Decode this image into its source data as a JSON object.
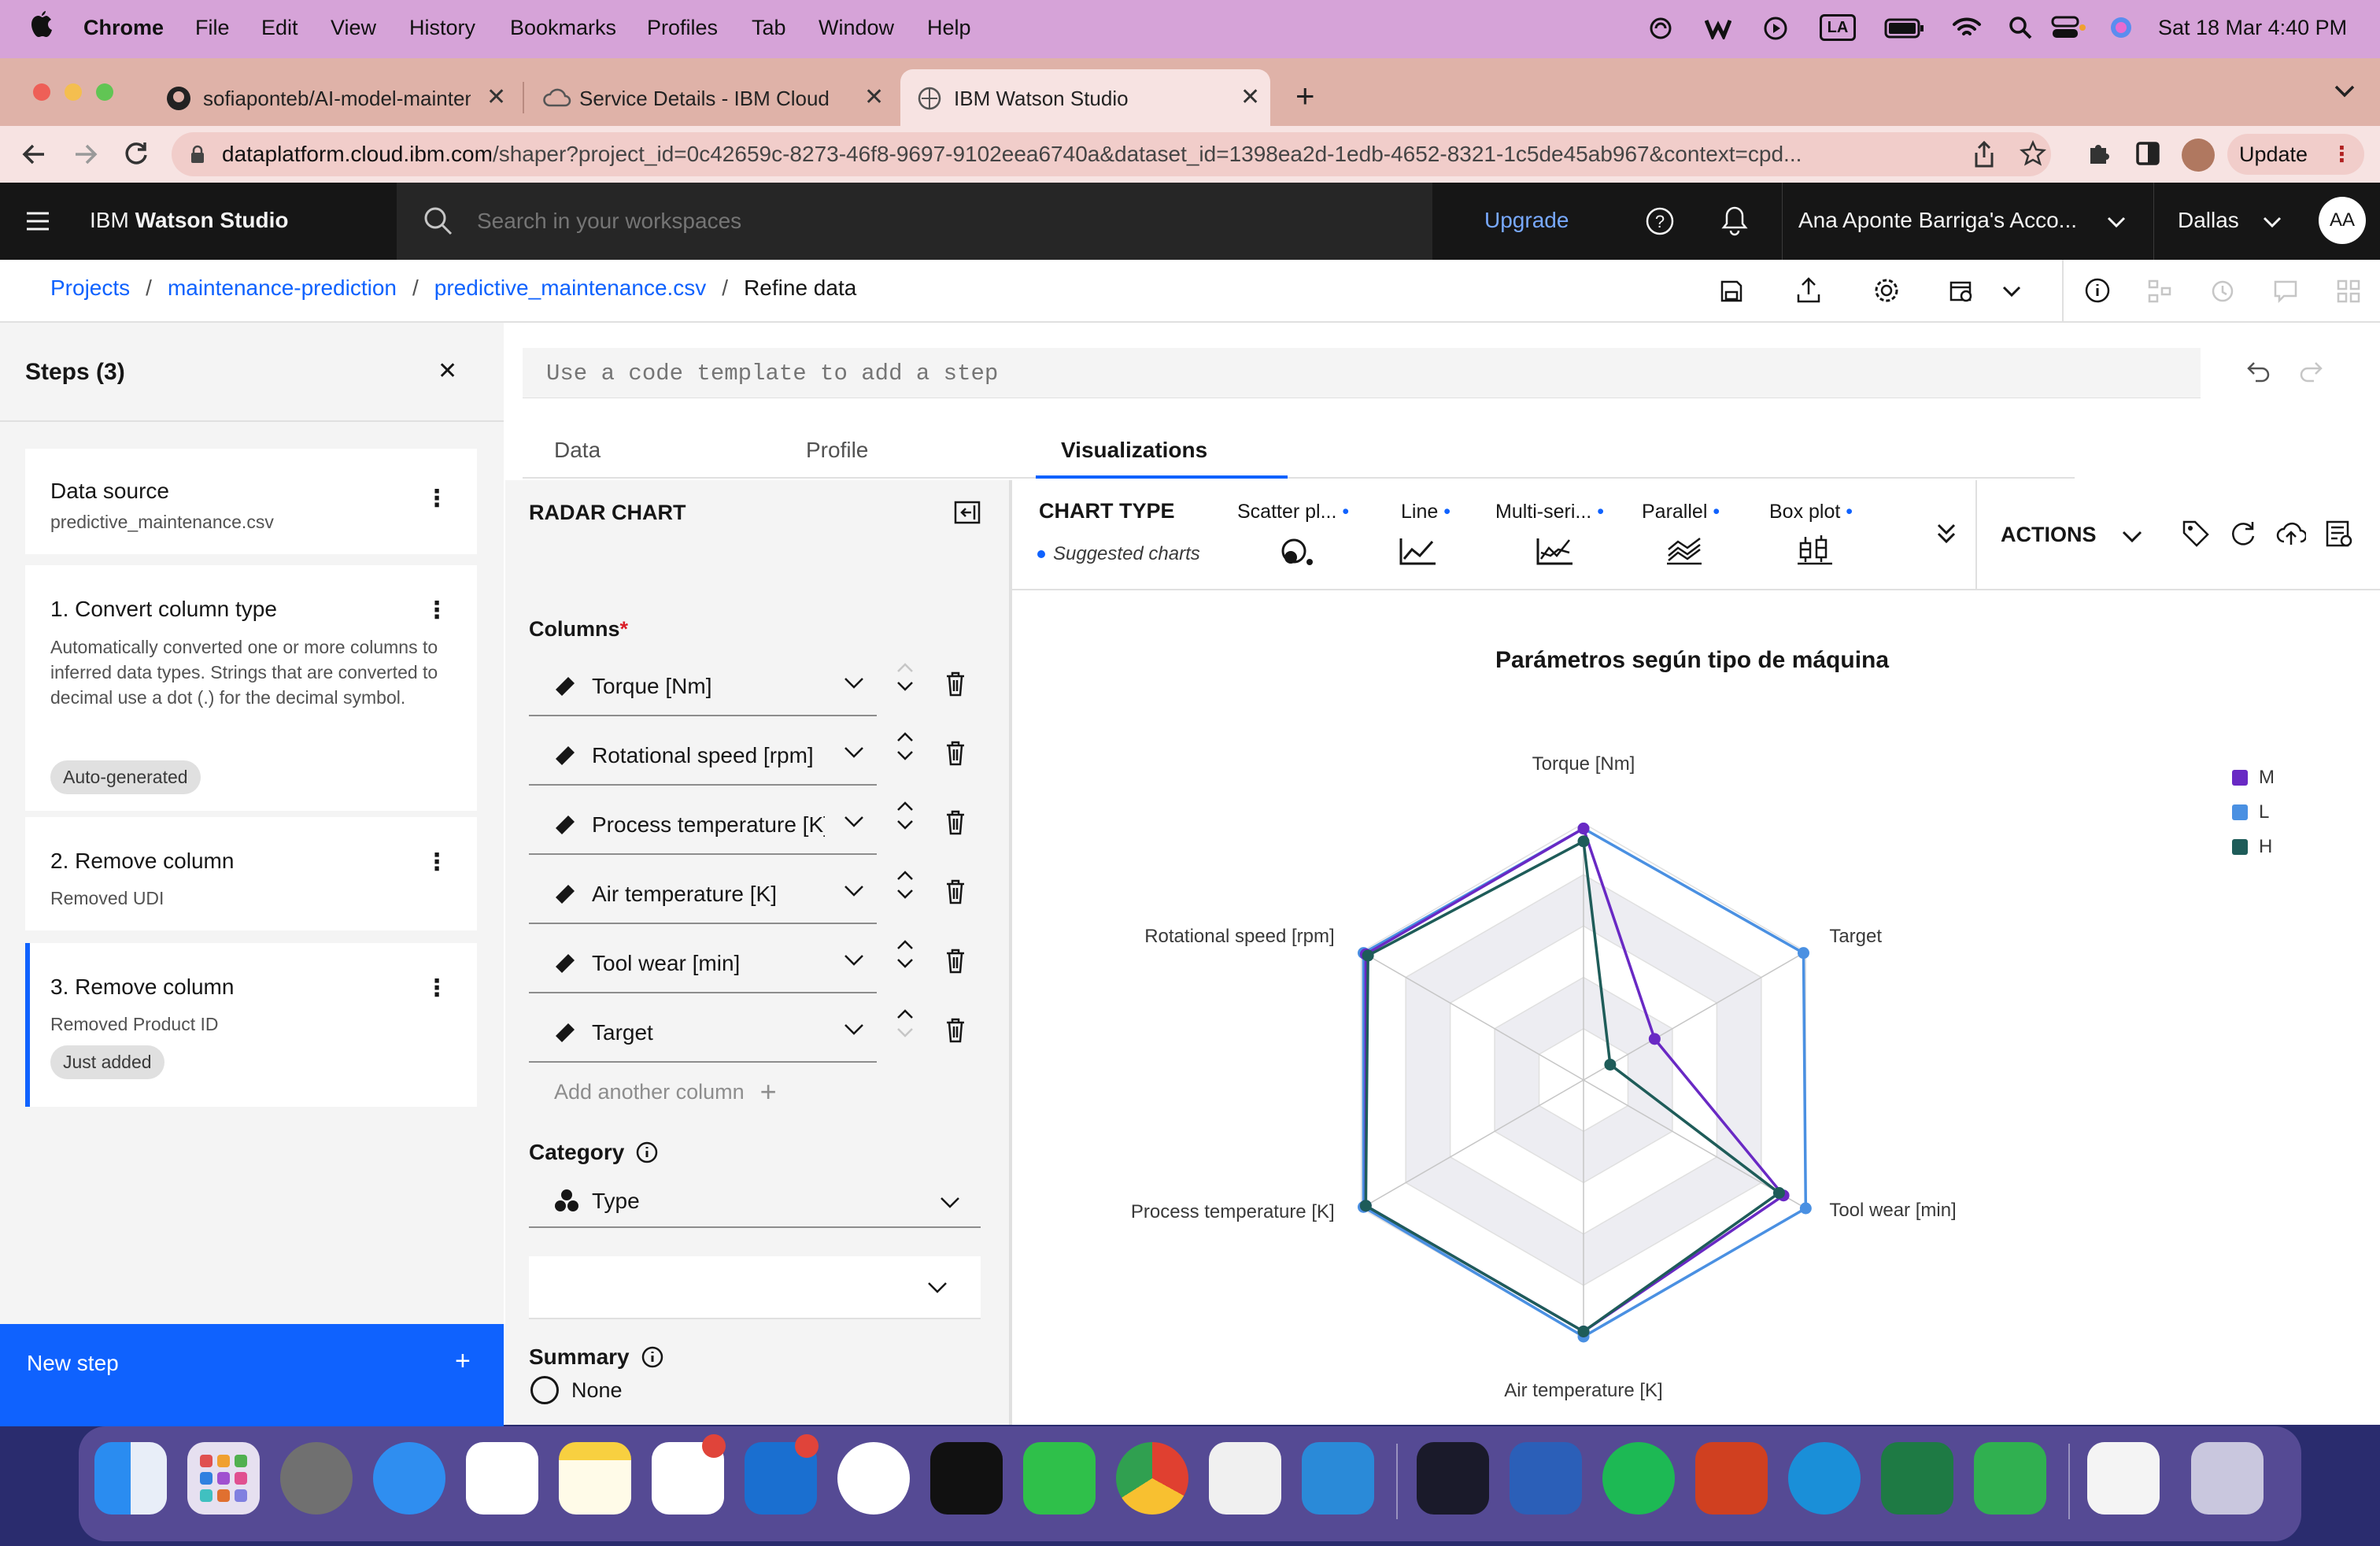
{
  "menubar": {
    "app": "Chrome",
    "items": [
      "File",
      "Edit",
      "View",
      "History",
      "Bookmarks",
      "Profiles",
      "Tab",
      "Window",
      "Help"
    ],
    "status_badge": "LA",
    "datetime": "Sat 18 Mar  4:40 PM"
  },
  "browser": {
    "tabs": [
      {
        "title": "sofiaponteb/AI-model-mainten"
      },
      {
        "title": "Service Details - IBM Cloud"
      },
      {
        "title": "IBM Watson Studio"
      }
    ],
    "url_domain": "dataplatform.cloud.ibm.com",
    "url_path": "/shaper?project_id=0c42659c-8273-46f8-9697-9102eea6740a&dataset_id=1398ea2d-1edb-4652-8321-1c5de45ab967&context=cpd...",
    "update_label": "Update"
  },
  "header": {
    "brand_light": "IBM",
    "brand_bold": "Watson Studio",
    "search_placeholder": "Search in your workspaces",
    "upgrade": "Upgrade",
    "account": "Ana Aponte Barriga's Acco...",
    "region": "Dallas",
    "avatar": "AA"
  },
  "breadcrumb": {
    "items": [
      "Projects",
      "maintenance-prediction",
      "predictive_maintenance.csv"
    ],
    "current": "Refine data"
  },
  "steps": {
    "title": "Steps (3)",
    "source": {
      "title": "Data source",
      "subtitle": "predictive_maintenance.csv"
    },
    "items": [
      {
        "title": "1. Convert column type",
        "desc": "Automatically converted one or more columns to inferred data types. Strings that are converted to decimal use a dot (.) for the decimal symbol.",
        "tag": "Auto-generated"
      },
      {
        "title": "2. Remove column",
        "desc": "Removed UDI",
        "tag": ""
      },
      {
        "title": "3. Remove column",
        "desc": "Removed Product ID",
        "tag": "Just added"
      }
    ],
    "new_step": "New step"
  },
  "code_placeholder": "Use a code template to add a step",
  "tabs": [
    "Data",
    "Profile",
    "Visualizations"
  ],
  "config": {
    "title": "RADAR CHART",
    "columns_label": "Columns",
    "required_mark": "*",
    "columns": [
      "Torque [Nm]",
      "Rotational speed [rpm]",
      "Process temperature [K]",
      "Air temperature [K]",
      "Tool wear [min]",
      "Target"
    ],
    "add_column": "Add another column",
    "category_label": "Category",
    "category_value": "Type",
    "summary_label": "Summary",
    "summary_option": "None"
  },
  "chart_type": {
    "label": "CHART TYPE",
    "suggested": "Suggested charts",
    "options": [
      "Scatter pl...",
      "Line",
      "Multi-seri...",
      "Parallel",
      "Box plot"
    ],
    "actions": "ACTIONS"
  },
  "colors": {
    "accent": "#0f62fe",
    "M": "#6929c4",
    "L": "#4a90e2",
    "H": "#1e5c59"
  },
  "chart_data": {
    "type": "radar",
    "title": "Parámetros según tipo de máquina",
    "axes": [
      "Torque [Nm]",
      "Target",
      "Tool wear [min]",
      "Air temperature [K]",
      "Process temperature [K]",
      "Rotational speed [rpm]"
    ],
    "rlim": [
      0,
      1
    ],
    "series": [
      {
        "name": "M",
        "values": [
          0.98,
          0.32,
          0.9,
          0.98,
          0.98,
          0.98
        ]
      },
      {
        "name": "L",
        "values": [
          0.98,
          0.99,
          1.0,
          1.0,
          0.99,
          0.99
        ]
      },
      {
        "name": "H",
        "values": [
          0.93,
          0.12,
          0.88,
          0.98,
          0.98,
          0.97
        ]
      }
    ],
    "legend": "right"
  }
}
